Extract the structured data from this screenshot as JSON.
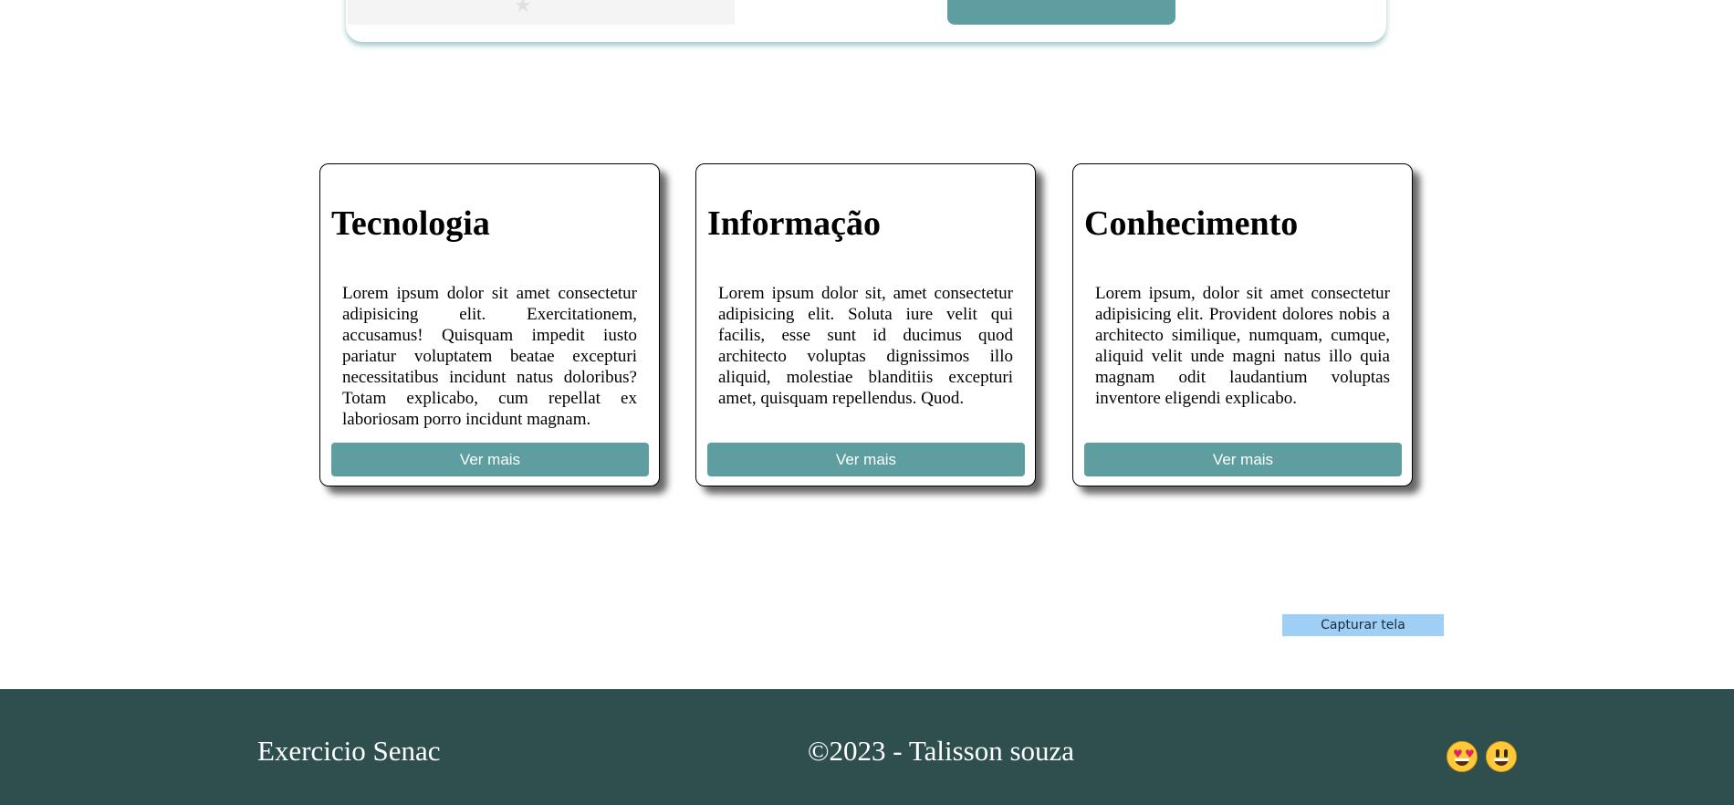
{
  "cards": [
    {
      "title": "Tecnologia",
      "text": "Lorem ipsum dolor sit amet consectetur adipisicing elit. Exercitationem, accusamus! Quisquam impedit iusto pariatur voluptatem beatae excepturi necessitatibus incidunt natus doloribus? Totam explicabo, cum repellat ex laboriosam porro incidunt magnam.",
      "button": "Ver mais"
    },
    {
      "title": "Informação",
      "text": "Lorem ipsum dolor sit, amet consectetur adipisicing elit. Soluta iure velit qui facilis, esse sunt id ducimus quod architecto voluptas dignissimos illo aliquid, molestiae blanditiis excepturi amet, quisquam repellendus. Quod.",
      "button": "Ver mais"
    },
    {
      "title": "Conhecimento",
      "text": "Lorem ipsum, dolor sit amet consectetur adipisicing elit. Provident dolores nobis a architecto similique, numquam, cumque, aliquid velit unde magni natus illo quia magnam odit laudantium voluptas inventore eligendi explicabo.",
      "button": "Ver mais"
    }
  ],
  "capture_button": "Capturar tela",
  "footer": {
    "brand": "Exercicio Senac",
    "copyright": "©2023 - Talisson souza",
    "emojis": [
      "heart-eyes-emoji-icon",
      "grinning-emoji-icon"
    ]
  },
  "colors": {
    "accent": "#5f9ea0",
    "footer_bg": "#2f4f4f",
    "capture_bg": "#a0cff5"
  }
}
